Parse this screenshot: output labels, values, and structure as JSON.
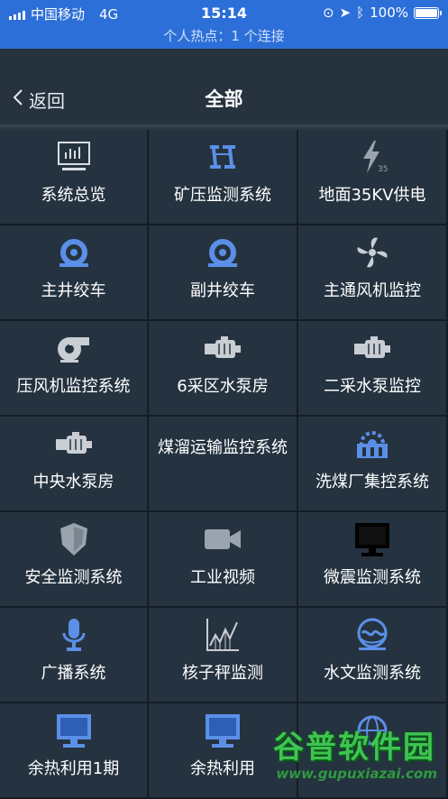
{
  "status_bar": {
    "carrier": "中国移动",
    "network": "4G",
    "time": "15:14",
    "battery": "100%"
  },
  "hotspot_text": "个人热点：1 个连接",
  "nav": {
    "back_label": "返回",
    "title": "全部"
  },
  "items": [
    {
      "label": "系统总览",
      "icon": "monitor-chart-icon"
    },
    {
      "label": "矿压监测系统",
      "icon": "mine-pressure-icon"
    },
    {
      "label": "地面35KV供电",
      "icon": "lightning-35-icon"
    },
    {
      "label": "主井绞车",
      "icon": "winch-icon"
    },
    {
      "label": "副井绞车",
      "icon": "winch-icon"
    },
    {
      "label": "主通风机监控",
      "icon": "fan-icon"
    },
    {
      "label": "压风机监控系统",
      "icon": "blower-icon"
    },
    {
      "label": "6采区水泵房",
      "icon": "pump-icon"
    },
    {
      "label": "二采水泵监控",
      "icon": "pump-icon"
    },
    {
      "label": "中央水泵房",
      "icon": "pump-icon"
    },
    {
      "label": "煤溜运输监控系统",
      "icon": ""
    },
    {
      "label": "洗煤厂集控系统",
      "icon": "coal-wash-icon"
    },
    {
      "label": "安全监测系统",
      "icon": "shield-icon"
    },
    {
      "label": "工业视频",
      "icon": "video-camera-icon"
    },
    {
      "label": "微震监测系统",
      "icon": "display-icon"
    },
    {
      "label": "广播系统",
      "icon": "microphone-icon"
    },
    {
      "label": "核子秤监测",
      "icon": "line-chart-icon"
    },
    {
      "label": "水文监测系统",
      "icon": "water-gauge-icon"
    },
    {
      "label": "余热利用1期",
      "icon": "blue-monitor-icon"
    },
    {
      "label": "余热利用",
      "icon": "blue-monitor-icon"
    },
    {
      "label": "",
      "icon": "globe-icon"
    }
  ],
  "colors": {
    "status_bar": "#2d6fd8",
    "background": "#1f2a35",
    "cell": "#253340",
    "icon_blue": "#5b8fe8",
    "icon_gray": "#9aa4ae"
  },
  "watermark": {
    "title": "谷普软件园",
    "url": "www.gupuxiazai.com"
  }
}
